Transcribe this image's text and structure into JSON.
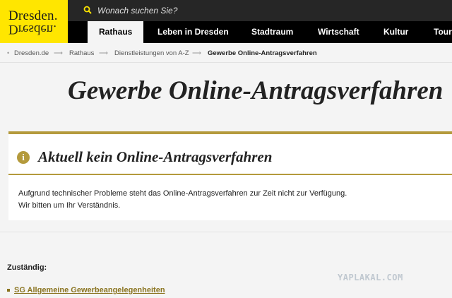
{
  "logo": {
    "text": "Dresden.",
    "mirror_text": "Dresden."
  },
  "search": {
    "placeholder": "Wonach suchen Sie?"
  },
  "nav": {
    "items": [
      {
        "label": "Rathaus",
        "active": true
      },
      {
        "label": "Leben in Dresden"
      },
      {
        "label": "Stadtraum"
      },
      {
        "label": "Wirtschaft"
      },
      {
        "label": "Kultur"
      },
      {
        "label": "Touri"
      }
    ]
  },
  "breadcrumb": [
    "Dresden.de",
    "Rathaus",
    "Dienstleistungen von A-Z",
    "Gewerbe Online-Antragsverfahren"
  ],
  "page": {
    "title": "Gewerbe Online-Antragsverfahren"
  },
  "notice": {
    "heading": "Aktuell kein Online-Antragsverfahren",
    "line1": "Aufgrund technischer Probleme steht das Online-Antragsverfahren zur Zeit nicht zur Verfügung.",
    "line2": "Wir bitten um Ihr Verständnis."
  },
  "responsible": {
    "label": "Zuständig:",
    "link": "SG Allgemeine Gewerbeangelegenheiten"
  },
  "watermark": "YAPLAKAL.COM",
  "colors": {
    "brand_yellow": "#ffe600",
    "accent_gold": "#b49a3c",
    "link": "#8a7420"
  }
}
